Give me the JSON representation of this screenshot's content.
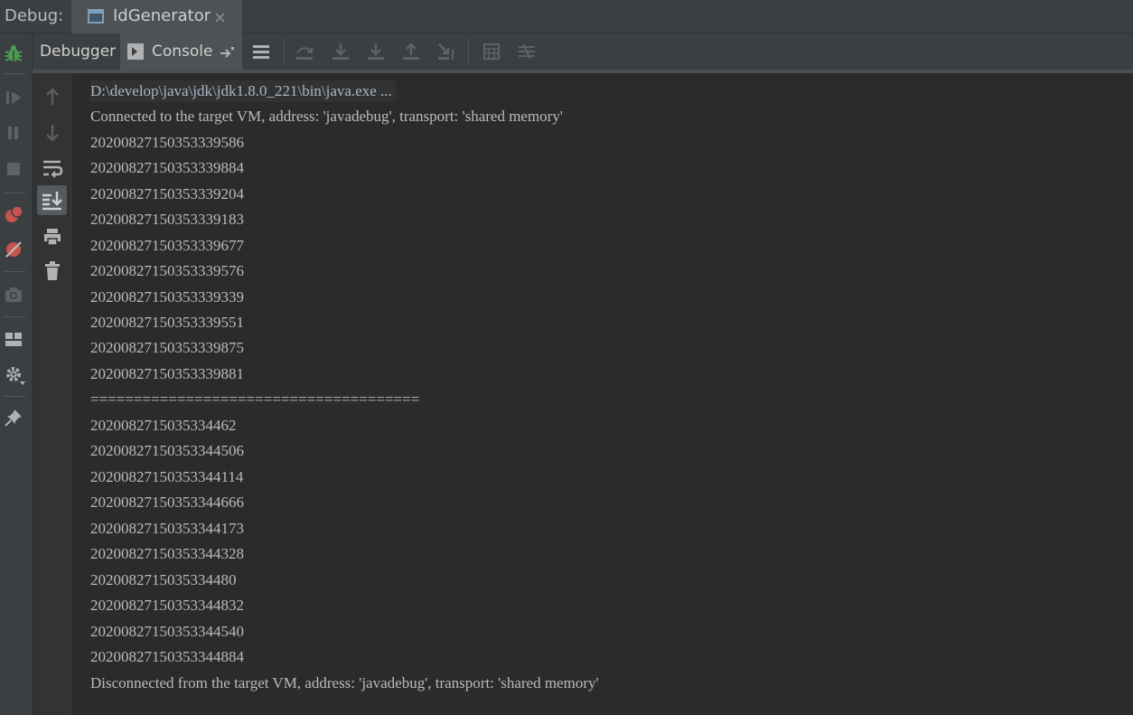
{
  "titlebar": {
    "label": "Debug:",
    "tab_title": "IdGenerator",
    "tab_icon": "window-icon",
    "close_icon": "close-icon"
  },
  "left_toolbar": {
    "icons": [
      "bug-icon",
      "resume-icon",
      "pause-icon",
      "stop-icon",
      "view-breakpoints-icon",
      "mute-breakpoints-icon",
      "camera-icon",
      "layout-icon",
      "settings-icon",
      "pin-icon"
    ],
    "accent_color": "#499c54",
    "breakpoint_color": "#c75450"
  },
  "debug_toolbar": {
    "debugger_tab": "Debugger",
    "console_tab": "Console",
    "icons": [
      "restore-layout-icon",
      "step-over-icon",
      "step-into-icon",
      "force-step-into-icon",
      "step-out-icon",
      "run-to-cursor-icon",
      "evaluate-expression-icon",
      "trace-stream-icon"
    ]
  },
  "console_toolbar": {
    "icons": [
      "up-arrow-icon",
      "down-arrow-icon",
      "soft-wrap-icon",
      "scroll-to-end-icon",
      "print-icon",
      "trash-icon"
    ]
  },
  "console": {
    "lines": [
      "D:\\develop\\java\\jdk\\jdk1.8.0_221\\bin\\java.exe ...",
      "Connected to the target VM, address: 'javadebug', transport: 'shared memory'",
      "20200827150353339586",
      "20200827150353339884",
      "20200827150353339204",
      "20200827150353339183",
      "20200827150353339677",
      "20200827150353339576",
      "20200827150353339339",
      "20200827150353339551",
      "20200827150353339875",
      "20200827150353339881",
      "======================================",
      "2020082715035334462",
      "20200827150353344506",
      "20200827150353344114",
      "20200827150353344666",
      "20200827150353344173",
      "20200827150353344328",
      "2020082715035334480",
      "20200827150353344832",
      "20200827150353344540",
      "20200827150353344884",
      "Disconnected from the target VM, address: 'javadebug', transport: 'shared memory'"
    ]
  }
}
